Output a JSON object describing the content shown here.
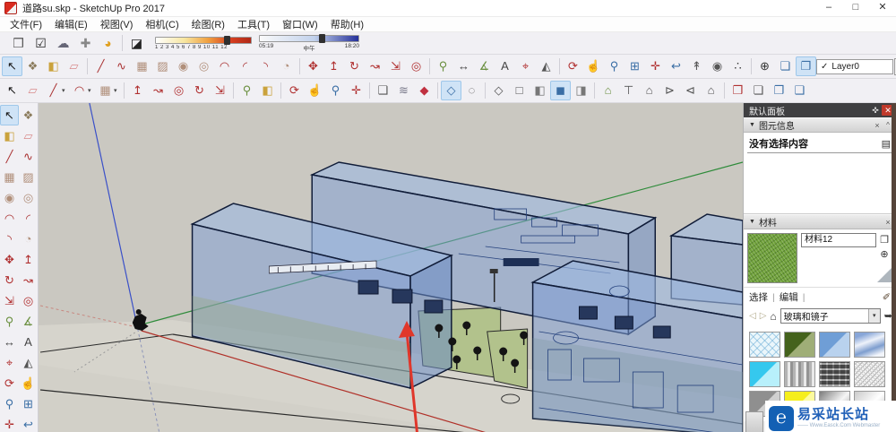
{
  "window": {
    "title": "道路su.skp - SketchUp Pro 2017",
    "controls": {
      "minimize": "–",
      "maximize": "□",
      "close": "✕"
    }
  },
  "menu": {
    "items": [
      {
        "n": "menu-file",
        "label": "文件(F)"
      },
      {
        "n": "menu-edit",
        "label": "编辑(E)"
      },
      {
        "n": "menu-view",
        "label": "视图(V)"
      },
      {
        "n": "menu-camera",
        "label": "相机(C)"
      },
      {
        "n": "menu-draw",
        "label": "绘图(R)"
      },
      {
        "n": "menu-tools",
        "label": "工具(T)"
      },
      {
        "n": "menu-window",
        "label": "窗口(W)"
      },
      {
        "n": "menu-help",
        "label": "帮助(H)"
      }
    ]
  },
  "quickbar": {
    "icons": [
      {
        "n": "sketchup-model-icon",
        "g": "❒",
        "c": "#555"
      },
      {
        "n": "validate-check-icon",
        "g": "☑",
        "c": "#222"
      },
      {
        "n": "warehouse-cloud-icon",
        "g": "☁",
        "c": "#667"
      },
      {
        "n": "add-extension-icon",
        "g": "✚",
        "c": "#888"
      },
      {
        "n": "layout-circle-icon",
        "g": "◕",
        "c": "#e0a020"
      },
      {
        "sep": 1
      },
      {
        "n": "shadow-toggle-icon",
        "g": "◪",
        "c": "#222"
      }
    ],
    "date_ticks": "1 2 3 4 5 6 7 8 9 10 11 12",
    "time_start": "05:19",
    "time_noon": "中午",
    "time_end": "18:20"
  },
  "row1": {
    "icons": [
      {
        "n": "select-tool",
        "g": "↖",
        "c": "#1a1a1a",
        "a": 1
      },
      {
        "n": "make-component-tool",
        "g": "❖",
        "c": "#8a7a5a"
      },
      {
        "n": "paint-bucket-tool",
        "g": "◧",
        "c": "#caa23c"
      },
      {
        "n": "eraser-tool",
        "g": "▱",
        "c": "#d98c8c"
      },
      {
        "sep": 1
      },
      {
        "n": "line-tool",
        "g": "╱",
        "c": "#a33"
      },
      {
        "n": "freehand-tool",
        "g": "∿",
        "c": "#a33"
      },
      {
        "n": "rectangle-tool",
        "g": "▦",
        "c": "#b08f7a"
      },
      {
        "n": "rotated-rectangle-tool",
        "g": "▨",
        "c": "#b08f7a"
      },
      {
        "n": "circle-tool",
        "g": "◉",
        "c": "#b08f7a"
      },
      {
        "n": "polygon-tool",
        "g": "◎",
        "c": "#b08f7a"
      },
      {
        "n": "arc-tool",
        "g": "◠",
        "c": "#a33"
      },
      {
        "n": "two-point-arc-tool",
        "g": "◜",
        "c": "#a33"
      },
      {
        "n": "three-point-arc-tool",
        "g": "◝",
        "c": "#a33"
      },
      {
        "n": "pie-tool",
        "g": "◔",
        "c": "#b08f7a"
      },
      {
        "sep": 1
      },
      {
        "n": "move-tool",
        "g": "✥",
        "c": "#b03030"
      },
      {
        "n": "push-pull-tool",
        "g": "↥",
        "c": "#b03030"
      },
      {
        "n": "rotate-tool",
        "g": "↻",
        "c": "#b03030"
      },
      {
        "n": "follow-me-tool",
        "g": "↝",
        "c": "#b03030"
      },
      {
        "n": "scale-tool",
        "g": "⇲",
        "c": "#b03030"
      },
      {
        "n": "offset-tool",
        "g": "◎",
        "c": "#b03030"
      },
      {
        "sep": 1
      },
      {
        "n": "tape-measure-tool",
        "g": "⚲",
        "c": "#6a8f3f"
      },
      {
        "n": "dimension-tool",
        "g": "↔",
        "c": "#444"
      },
      {
        "n": "protractor-tool",
        "g": "∡",
        "c": "#6a8f3f"
      },
      {
        "n": "text-tool",
        "g": "A",
        "c": "#444"
      },
      {
        "n": "axes-tool",
        "g": "⌖",
        "c": "#b03030"
      },
      {
        "n": "three-d-text-tool",
        "g": "◭",
        "c": "#555"
      },
      {
        "sep": 1
      },
      {
        "n": "orbit-tool",
        "g": "⟳",
        "c": "#b03030"
      },
      {
        "n": "pan-tool",
        "g": "☝",
        "c": "#c89a6a"
      },
      {
        "n": "zoom-tool",
        "g": "⚲",
        "c": "#3a6ea5"
      },
      {
        "n": "zoom-window-tool",
        "g": "⊞",
        "c": "#3a6ea5"
      },
      {
        "n": "zoom-extents-tool",
        "g": "✛",
        "c": "#b03030"
      },
      {
        "n": "zoom-previous-tool",
        "g": "↩",
        "c": "#3a6ea5"
      },
      {
        "n": "position-camera-tool",
        "g": "↟",
        "c": "#555"
      },
      {
        "n": "look-around-tool",
        "g": "◉",
        "c": "#555"
      },
      {
        "n": "walk-tool",
        "g": "∴",
        "c": "#333"
      },
      {
        "sep": 1
      },
      {
        "n": "axes-origin-toggle",
        "g": "⊕",
        "c": "#333"
      },
      {
        "n": "display-section-planes-button",
        "g": "❏",
        "c": "#3a6ea5"
      },
      {
        "n": "display-section-cuts-button",
        "g": "❐",
        "c": "#3a6ea5",
        "a": 1
      }
    ]
  },
  "layers": {
    "check": "✓",
    "value": "Layer0",
    "caret": "▾"
  },
  "row2": {
    "icons": [
      {
        "n": "select-tool-2",
        "g": "↖",
        "c": "#1a1a1a"
      },
      {
        "n": "eraser-tool-2",
        "g": "▱",
        "c": "#d98c8c"
      },
      {
        "n": "line-tool-2",
        "g": "╱",
        "c": "#a33",
        "dd": 1
      },
      {
        "n": "arc-tool-2",
        "g": "◠",
        "c": "#a33",
        "dd": 1
      },
      {
        "n": "rectangle-tool-2",
        "g": "▦",
        "c": "#b08f7a",
        "dd": 1
      },
      {
        "sep": 1
      },
      {
        "n": "push-pull-tool-2",
        "g": "↥",
        "c": "#b03030"
      },
      {
        "n": "follow-me-tool-2",
        "g": "↝",
        "c": "#b03030"
      },
      {
        "n": "offset-tool-2",
        "g": "◎",
        "c": "#b03030"
      },
      {
        "n": "rotate-tool-2",
        "g": "↻",
        "c": "#b03030"
      },
      {
        "n": "scale-tool-2",
        "g": "⇲",
        "c": "#b03030"
      },
      {
        "sep": 1
      },
      {
        "n": "tape-measure-tool-2",
        "g": "⚲",
        "c": "#6a8f3f"
      },
      {
        "n": "paint-bucket-tool-2",
        "g": "◧",
        "c": "#caa23c"
      },
      {
        "sep": 1
      },
      {
        "n": "orbit-tool-2",
        "g": "⟳",
        "c": "#b03030"
      },
      {
        "n": "pan-tool-2",
        "g": "☝",
        "c": "#c89a6a"
      },
      {
        "n": "zoom-tool-2",
        "g": "⚲",
        "c": "#3a6ea5"
      },
      {
        "n": "zoom-extents-tool-2",
        "g": "✛",
        "c": "#b03030"
      },
      {
        "sep": 1
      },
      {
        "n": "shadows-dialog-button",
        "g": "❑",
        "c": "#555"
      },
      {
        "n": "fog-toggle-button",
        "g": "≋",
        "c": "#778"
      },
      {
        "n": "material-browser-button",
        "g": "◆",
        "c": "#c03040"
      },
      {
        "sep": 1
      },
      {
        "n": "x-ray-mode-button",
        "g": "◇",
        "c": "#3a6ea5",
        "a": 1
      },
      {
        "n": "back-edges-mode-button",
        "g": "◌",
        "c": "#555"
      },
      {
        "sep": 1
      },
      {
        "n": "wireframe-mode-button",
        "g": "◇",
        "c": "#555"
      },
      {
        "n": "hidden-line-mode-button",
        "g": "□",
        "c": "#555"
      },
      {
        "n": "shaded-mode-button",
        "g": "◧",
        "c": "#777"
      },
      {
        "n": "shaded-textures-mode-button",
        "g": "◼",
        "c": "#3a6ea5",
        "a": 1
      },
      {
        "n": "monochrome-mode-button",
        "g": "◨",
        "c": "#777"
      },
      {
        "sep": 1
      },
      {
        "n": "iso-view-button",
        "g": "⌂",
        "c": "#6a8f3f"
      },
      {
        "n": "top-view-button",
        "g": "⊤",
        "c": "#555"
      },
      {
        "n": "front-view-button",
        "g": "⌂",
        "c": "#555"
      },
      {
        "n": "right-view-button",
        "g": "⊳",
        "c": "#555"
      },
      {
        "n": "back-view-button",
        "g": "⊲",
        "c": "#555"
      },
      {
        "n": "left-view-button",
        "g": "⌂",
        "c": "#555"
      },
      {
        "sep": 1
      },
      {
        "n": "section-plane-tool",
        "g": "❒",
        "c": "#b03030"
      },
      {
        "n": "display-section-planes-button-2",
        "g": "❏",
        "c": "#555"
      },
      {
        "n": "display-section-cuts-button-2",
        "g": "❐",
        "c": "#3a6ea5"
      },
      {
        "n": "section-fill-button",
        "g": "❑",
        "c": "#3a6ea5"
      }
    ]
  },
  "left_toolbar": {
    "icons": [
      {
        "n": "lt-select-tool",
        "g": "↖",
        "c": "#1a1a1a",
        "a": 1
      },
      {
        "n": "lt-make-component-tool",
        "g": "❖",
        "c": "#8a7a5a"
      },
      {
        "n": "lt-paint-bucket-tool",
        "g": "◧",
        "c": "#caa23c"
      },
      {
        "n": "lt-eraser-tool",
        "g": "▱",
        "c": "#d98c8c"
      },
      {
        "n": "lt-line-tool",
        "g": "╱",
        "c": "#a33"
      },
      {
        "n": "lt-freehand-tool",
        "g": "∿",
        "c": "#a33"
      },
      {
        "n": "lt-rectangle-tool",
        "g": "▦",
        "c": "#b08f7a"
      },
      {
        "n": "lt-rotated-rectangle-tool",
        "g": "▨",
        "c": "#b08f7a"
      },
      {
        "n": "lt-circle-tool",
        "g": "◉",
        "c": "#b08f7a"
      },
      {
        "n": "lt-polygon-tool",
        "g": "◎",
        "c": "#b08f7a"
      },
      {
        "n": "lt-arc-tool",
        "g": "◠",
        "c": "#a33"
      },
      {
        "n": "lt-two-point-arc-tool",
        "g": "◜",
        "c": "#a33"
      },
      {
        "n": "lt-three-point-arc-tool",
        "g": "◝",
        "c": "#a33"
      },
      {
        "n": "lt-pie-tool",
        "g": "◔",
        "c": "#b08f7a"
      },
      {
        "n": "lt-move-tool",
        "g": "✥",
        "c": "#b03030"
      },
      {
        "n": "lt-push-pull-tool",
        "g": "↥",
        "c": "#b03030"
      },
      {
        "n": "lt-rotate-tool",
        "g": "↻",
        "c": "#b03030"
      },
      {
        "n": "lt-follow-me-tool",
        "g": "↝",
        "c": "#b03030"
      },
      {
        "n": "lt-scale-tool",
        "g": "⇲",
        "c": "#b03030"
      },
      {
        "n": "lt-offset-tool",
        "g": "◎",
        "c": "#b03030"
      },
      {
        "n": "lt-tape-measure-tool",
        "g": "⚲",
        "c": "#6a8f3f"
      },
      {
        "n": "lt-protractor-tool",
        "g": "∡",
        "c": "#6a8f3f"
      },
      {
        "n": "lt-dimension-tool",
        "g": "↔",
        "c": "#444"
      },
      {
        "n": "lt-text-tool",
        "g": "A",
        "c": "#444"
      },
      {
        "n": "lt-axes-tool",
        "g": "⌖",
        "c": "#b03030"
      },
      {
        "n": "lt-three-d-text-tool",
        "g": "◭",
        "c": "#555"
      },
      {
        "n": "lt-orbit-tool",
        "g": "⟳",
        "c": "#b03030"
      },
      {
        "n": "lt-pan-tool",
        "g": "☝",
        "c": "#c89a6a"
      },
      {
        "n": "lt-zoom-tool",
        "g": "⚲",
        "c": "#3a6ea5"
      },
      {
        "n": "lt-zoom-window-tool",
        "g": "⊞",
        "c": "#3a6ea5"
      },
      {
        "n": "lt-zoom-extents-tool",
        "g": "✛",
        "c": "#b03030"
      },
      {
        "n": "lt-zoom-previous-tool",
        "g": "↩",
        "c": "#3a6ea5"
      }
    ]
  },
  "panel": {
    "title": "默认面板",
    "entity_info": {
      "title": "图元信息",
      "empty": "没有选择内容"
    },
    "materials": {
      "title": "材料",
      "name": "材料12",
      "tab_select": "选择",
      "tab_edit": "编辑",
      "collection": "玻璃和镜子",
      "swatches": [
        {
          "n": "swatch-translucent-glass",
          "s": "sw-hatch"
        },
        {
          "n": "swatch-green-glass",
          "s": "sw-green"
        },
        {
          "n": "swatch-blue-glass",
          "s": "sw-blue"
        },
        {
          "n": "swatch-sky-reflective-glass",
          "s": "sw-sky"
        },
        {
          "n": "swatch-cyan-glass",
          "s": "sw-cyan"
        },
        {
          "n": "swatch-corrugated-glass",
          "s": "sw-stripes"
        },
        {
          "n": "swatch-obscure-glass",
          "s": "sw-obscure"
        },
        {
          "n": "swatch-frosted-glass",
          "s": "sw-noise"
        },
        {
          "n": "swatch-gray-glass",
          "s": "sw-gray"
        },
        {
          "n": "swatch-yellow-glass",
          "s": "sw-yellow"
        },
        {
          "n": "swatch-mirror-dark",
          "s": "sw-mirror1"
        },
        {
          "n": "swatch-mirror-light",
          "s": "sw-mirror2"
        }
      ]
    }
  },
  "watermark": {
    "title": "易采站长站",
    "subtitle": "—— Www.Easck.Com Webmaster",
    "logo_glyph": "℮"
  },
  "viewport_colors": {
    "background": "#cac8c1",
    "ground": "#d6d4cc",
    "glass_fill": "#7e9ed4",
    "edge": "#101c38",
    "lawn": "#b2c28c",
    "axis_red": "#b03028",
    "axis_green": "#2e8b3a",
    "axis_blue": "#3a50c8",
    "annotation_arrow": "#e0372b"
  }
}
